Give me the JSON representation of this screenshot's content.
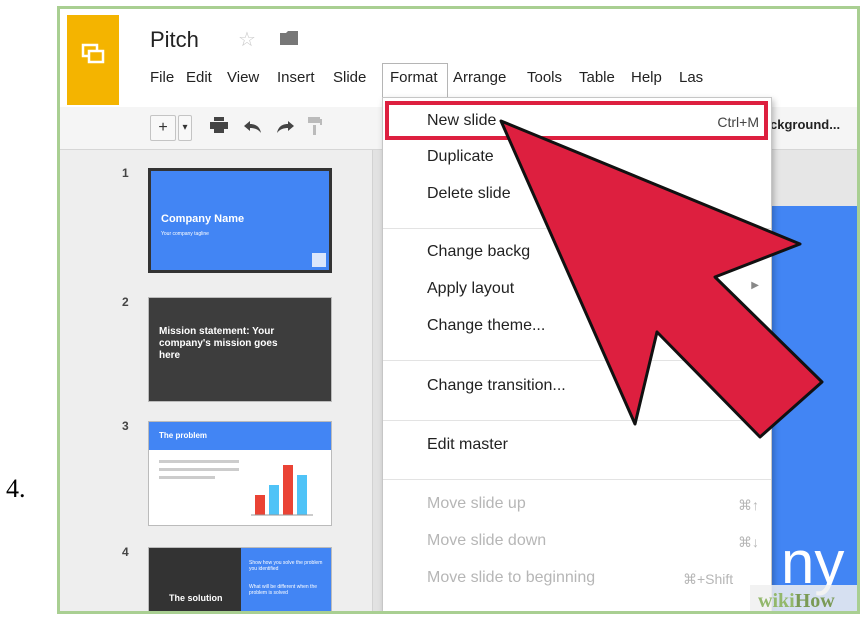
{
  "step_number": "4.",
  "app": {
    "title": "Pitch"
  },
  "menubar": [
    "File",
    "Edit",
    "View",
    "Insert",
    "Slide",
    "Format",
    "Arrange",
    "Tools",
    "Table",
    "Help",
    "Las"
  ],
  "toolbar": {
    "background_label": "ckground..."
  },
  "filmstrip": {
    "slides": [
      {
        "number": "1",
        "title": "Company Name",
        "subtitle": "Your company tagline"
      },
      {
        "number": "2",
        "title": "Mission statement: Your company's mission goes here"
      },
      {
        "number": "3",
        "title": "The problem"
      },
      {
        "number": "4",
        "title": "The solution",
        "text1": "Show how you solve the problem you identified",
        "text2": "What will be different when the problem is solved"
      }
    ]
  },
  "slide_menu": {
    "items": [
      {
        "label": "New slide",
        "shortcut": "Ctrl+M"
      },
      {
        "label": "Duplicate"
      },
      {
        "label": "Delete slide"
      },
      {
        "label": "Change backg"
      },
      {
        "label": "Apply layout"
      },
      {
        "label": "Change theme..."
      },
      {
        "label": "Change transition..."
      },
      {
        "label": "Edit master"
      },
      {
        "label": "Move slide up",
        "shortcut": "⌘↑"
      },
      {
        "label": "Move slide down",
        "shortcut": "⌘↓"
      },
      {
        "label": "Move slide to beginning",
        "shortcut": "⌘+Shift"
      }
    ]
  },
  "canvas": {
    "visible_text": "ny"
  },
  "watermark": {
    "part1": "wiki",
    "part2": "How"
  },
  "colors": {
    "logo": "#f4b400",
    "slide_blue": "#4285f4",
    "highlight": "#dd1f3f",
    "arrow": "#dd1f3f",
    "frame": "#a9cf92"
  }
}
